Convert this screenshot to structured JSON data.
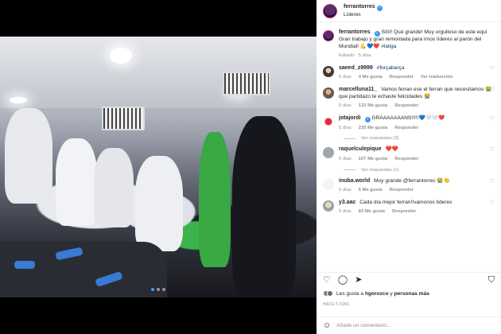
{
  "post": {
    "author": "ferrantorres",
    "location": "Líderes",
    "caption": "SIIII! Qué grande! Muy orgulloso de este equi Gran trabajo y gran remontada para irnos líderes al parón del Mundial! 💪💙❤️",
    "caption_tag": "#laliga",
    "caption_meta": "Editado · 5 días"
  },
  "comments": [
    {
      "user": "saeed_z9999",
      "text": "",
      "tag": "#forçabarça",
      "time": "5 días",
      "likes": "4 Me gusta",
      "reply": "Responder",
      "extra": "Ver traducción",
      "view_replies": ""
    },
    {
      "user": "marcelluna11_",
      "text": "Vamos ferran ese el ferran que necesitamos 😭 que partidazo te echaste felicidades 😭",
      "tag": "",
      "time": "5 días",
      "likes": "132 Me gusta",
      "reply": "Responder",
      "extra": "",
      "view_replies": ""
    },
    {
      "user": "jotajordi",
      "text": "GRAAAAAAANS!!!!!💙🤍🤍❤️",
      "tag": "",
      "time": "5 días",
      "likes": "235 Me gusta",
      "reply": "Responder",
      "extra": "",
      "view_replies": "Ver respuestas (3)"
    },
    {
      "user": "raquelculepique",
      "text": "❤️❤️",
      "tag": "",
      "time": "5 días",
      "likes": "107 Me gusta",
      "reply": "Responder",
      "extra": "",
      "view_replies": "Ver respuestas (1)"
    },
    {
      "user": "inuba.world",
      "text": "Muy grande @ferrantorres 😭👏",
      "tag": "",
      "time": "5 días",
      "likes": "5 Me gusta",
      "reply": "Responder",
      "extra": "",
      "view_replies": ""
    },
    {
      "user": "y3.aac",
      "text": "Cada día mejor ferran!!vamonos líderes",
      "tag": "",
      "time": "5 días",
      "likes": "83 Me gusta",
      "reply": "Responder",
      "extra": "",
      "view_replies": ""
    }
  ],
  "footer": {
    "likes_prefix": "Les gusta a",
    "likes_user": "hgorozco",
    "likes_join": "y",
    "likes_others": "personas más",
    "ago": "HACE 5 DÍAS",
    "comment_placeholder": "Añade un comentario..."
  },
  "icons": {
    "like": "heart-icon",
    "comment": "comment-icon",
    "share": "send-icon",
    "save": "bookmark-icon",
    "emoji": "smiley-icon"
  },
  "colors": {
    "link": "#00376b",
    "verified": "#3897f0",
    "carousel_active": "#3b9bff"
  }
}
